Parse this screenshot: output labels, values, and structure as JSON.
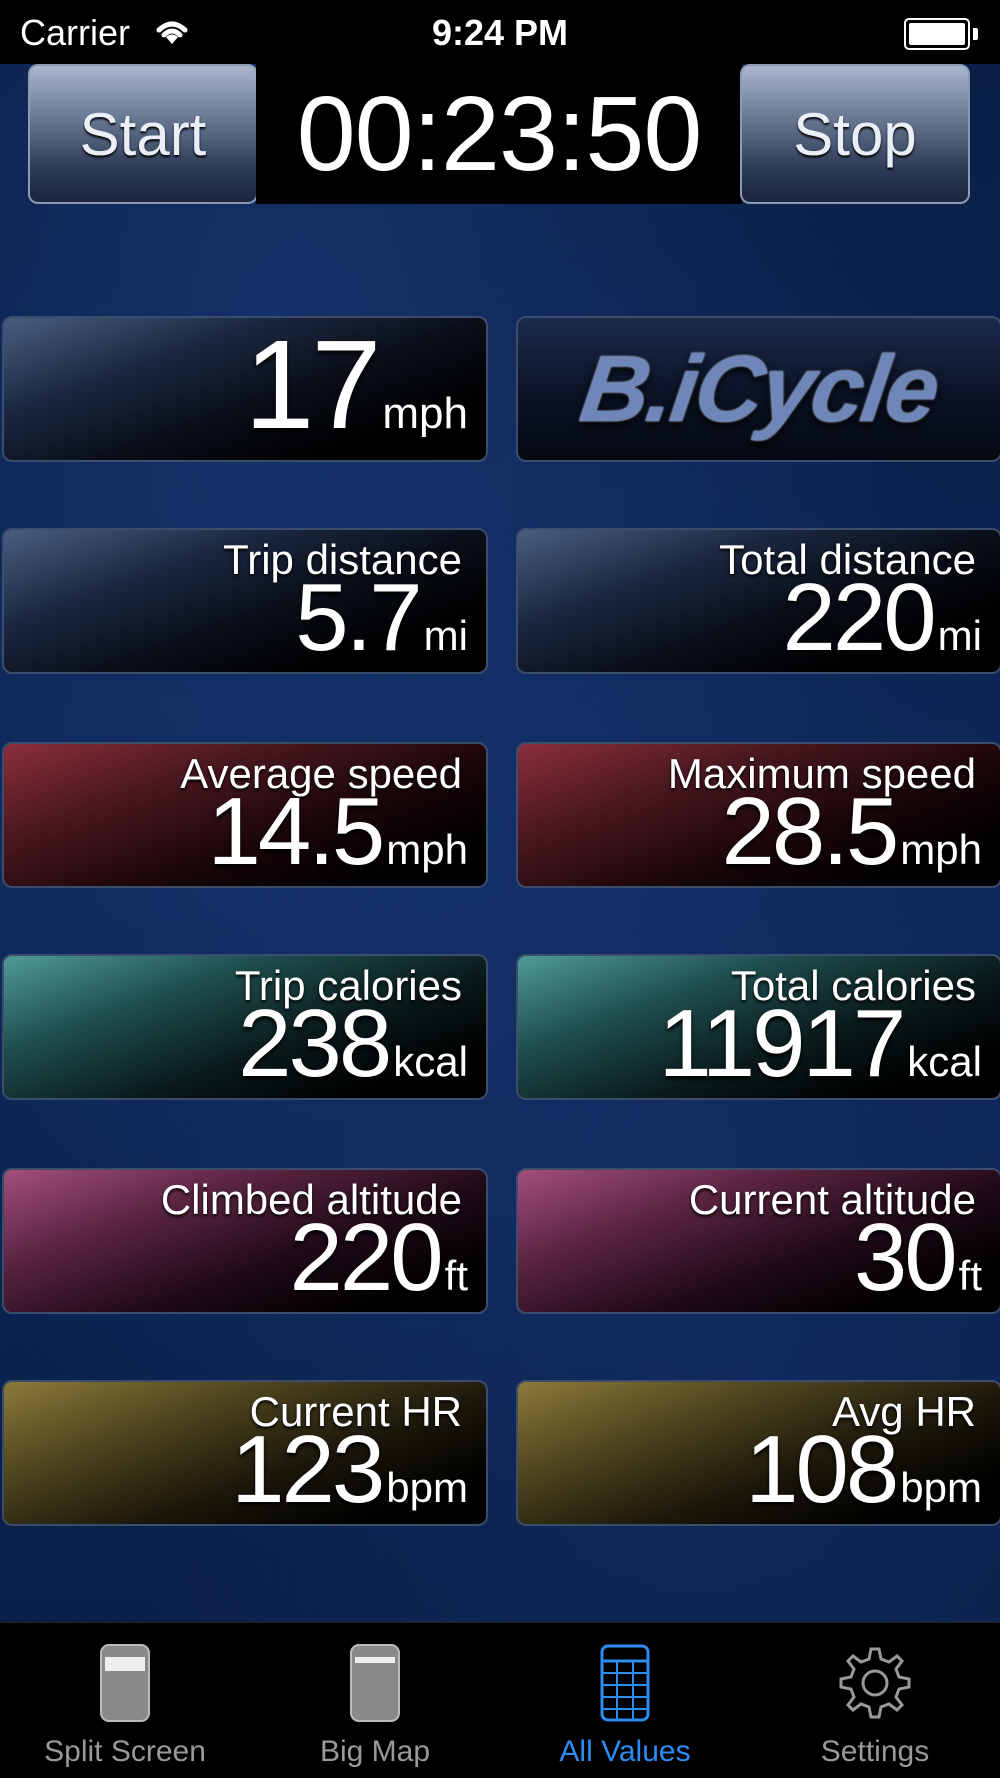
{
  "status_bar": {
    "carrier": "Carrier",
    "time": "9:24 PM"
  },
  "timer": {
    "start_label": "Start",
    "elapsed": "00:23:50",
    "stop_label": "Stop"
  },
  "speed": {
    "value": "17",
    "unit": "mph"
  },
  "logo": {
    "text": "B.iCycle"
  },
  "tiles": [
    {
      "label": "Trip distance",
      "value": "5.7",
      "unit": "mi"
    },
    {
      "label": "Total distance",
      "value": "220",
      "unit": "mi"
    },
    {
      "label": "Average speed",
      "value": "14.5",
      "unit": "mph"
    },
    {
      "label": "Maximum speed",
      "value": "28.5",
      "unit": "mph"
    },
    {
      "label": "Trip calories",
      "value": "238",
      "unit": "kcal"
    },
    {
      "label": "Total calories",
      "value": "11917",
      "unit": "kcal"
    },
    {
      "label": "Climbed altitude",
      "value": "220",
      "unit": "ft"
    },
    {
      "label": "Current altitude",
      "value": "30",
      "unit": "ft"
    },
    {
      "label": "Current HR",
      "value": "123",
      "unit": "bpm"
    },
    {
      "label": "Avg HR",
      "value": "108",
      "unit": "bpm"
    }
  ],
  "tab_bar": {
    "items": [
      {
        "label": "Split Screen",
        "icon": "phone-split-icon"
      },
      {
        "label": "Big Map",
        "icon": "phone-map-icon"
      },
      {
        "label": "All Values",
        "icon": "table-icon"
      },
      {
        "label": "Settings",
        "icon": "gear-icon"
      }
    ],
    "active_index": 2,
    "active_color": "#2c8cf4",
    "inactive_color": "#999999"
  }
}
